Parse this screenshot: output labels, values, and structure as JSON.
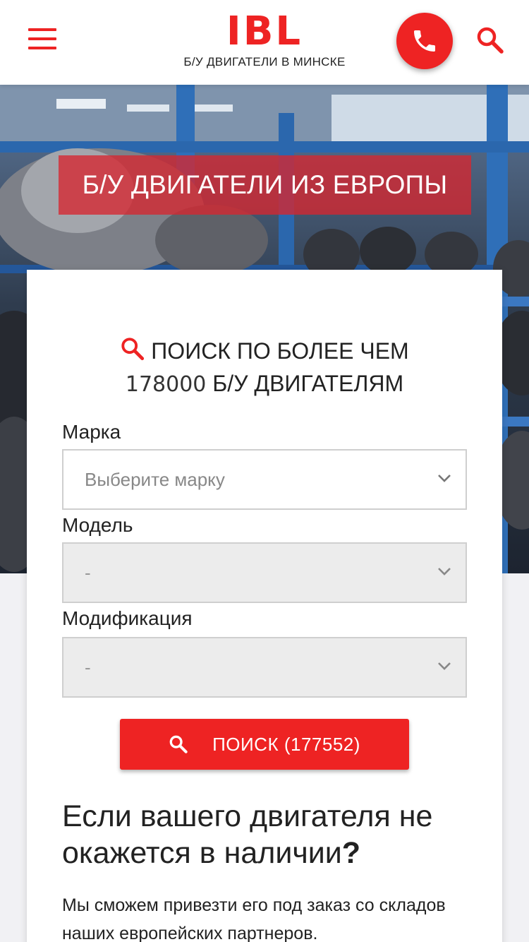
{
  "header": {
    "logo": "IBL",
    "tagline": "Б/У ДВИГАТЕЛИ В МИНСКЕ"
  },
  "icons": {
    "menu": "hamburger-icon",
    "phone": "phone-icon",
    "search": "search-icon",
    "dropdown": "chevron-down-icon"
  },
  "colors": {
    "accent": "#ee2323",
    "banner": "#d62630"
  },
  "hero": {
    "banner_text": "Б/У ДВИГАТЕЛИ ИЗ ЕВРОПЫ"
  },
  "search": {
    "title_line1": "ПОИСК ПО БОЛЕЕ ЧЕМ",
    "count": "178000",
    "title_line2_rest": "Б/У ДВИГАТЕЛЯМ",
    "fields": {
      "make": {
        "label": "Марка",
        "value": "Выберите марку"
      },
      "model": {
        "label": "Модель",
        "value": "-"
      },
      "modification": {
        "label": "Модификация",
        "value": "-"
      }
    },
    "button_label": "ПОИСК (177552)"
  },
  "notice": {
    "title": "Если вашего двигателя не окажется в наличии",
    "title_mark": "?",
    "text": "Мы сможем привезти его под заказ со складов наших европейских партнеров."
  }
}
